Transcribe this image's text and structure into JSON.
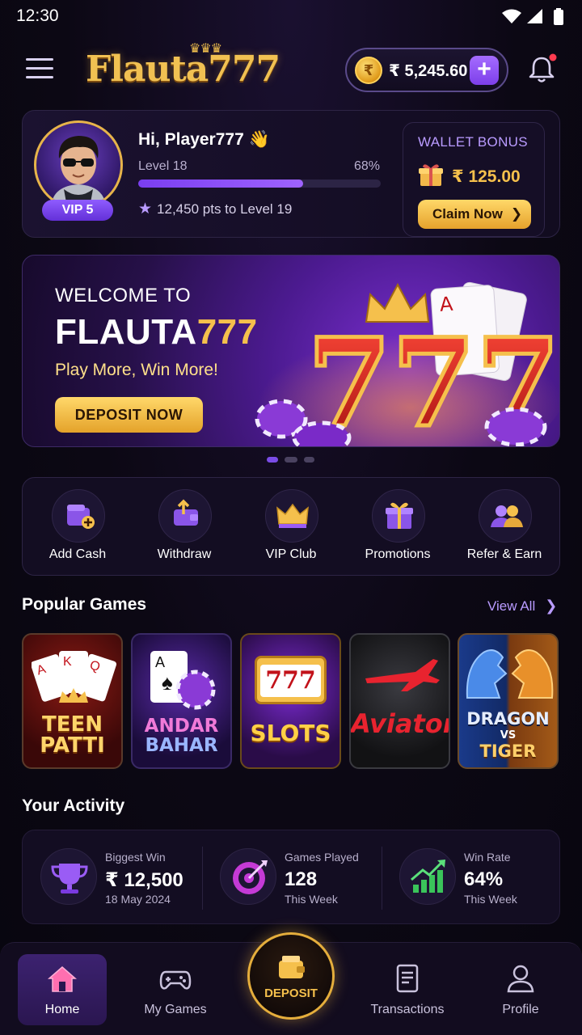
{
  "status_bar": {
    "time": "12:30"
  },
  "header": {
    "logo_text": "Flauta777",
    "balance": "₹ 5,245.60",
    "add_symbol": "+",
    "coin_symbol": "₹"
  },
  "profile": {
    "greeting": "Hi, Player777 👋",
    "vip": "VIP 5",
    "level_label": "Level 18",
    "level_progress_pct": "68%",
    "level_progress": 0.68,
    "points_text": "12,450 pts to Level 19",
    "bonus_title": "WALLET BONUS",
    "bonus_amount": "₹ 125.00",
    "claim_label": "Claim Now"
  },
  "banner": {
    "line1": "WELCOME TO",
    "brand_white": "FLAUTA",
    "brand_gold": "777",
    "tagline": "Play More, Win More!",
    "cta": "DEPOSIT NOW",
    "art_text": "777",
    "active_slide": 1,
    "slide_count": 3
  },
  "quick_actions": [
    {
      "label": "Add Cash",
      "icon": "wallet-plus-icon"
    },
    {
      "label": "Withdraw",
      "icon": "wallet-out-icon"
    },
    {
      "label": "VIP Club",
      "icon": "crown-icon"
    },
    {
      "label": "Promotions",
      "icon": "gift-icon"
    },
    {
      "label": "Refer & Earn",
      "icon": "users-icon"
    }
  ],
  "popular": {
    "title": "Popular Games",
    "view_all": "View All",
    "games": [
      {
        "line1": "TEEN",
        "line2": "PATTI"
      },
      {
        "line1": "ANDAR",
        "line2": "BAHAR"
      },
      {
        "line1": "SLOTS",
        "line2": "777"
      },
      {
        "line1": "Aviator",
        "line2": ""
      },
      {
        "line1": "DRAGON",
        "line2": "VS",
        "line3": "TIGER"
      }
    ]
  },
  "activity": {
    "title": "Your Activity",
    "stats": [
      {
        "label": "Biggest Win",
        "value": "₹ 12,500",
        "sub": "18 May 2024",
        "icon": "trophy-icon"
      },
      {
        "label": "Games Played",
        "value": "128",
        "sub": "This Week",
        "icon": "target-icon"
      },
      {
        "label": "Win Rate",
        "value": "64%",
        "sub": "This Week",
        "icon": "chart-up-icon"
      }
    ]
  },
  "nav": {
    "home": "Home",
    "my_games": "My Games",
    "deposit": "DEPOSIT",
    "transactions": "Transactions",
    "profile": "Profile"
  },
  "colors": {
    "accent_purple": "#8f5cff",
    "gold": "#f5c04c",
    "background": "#0c0814"
  }
}
